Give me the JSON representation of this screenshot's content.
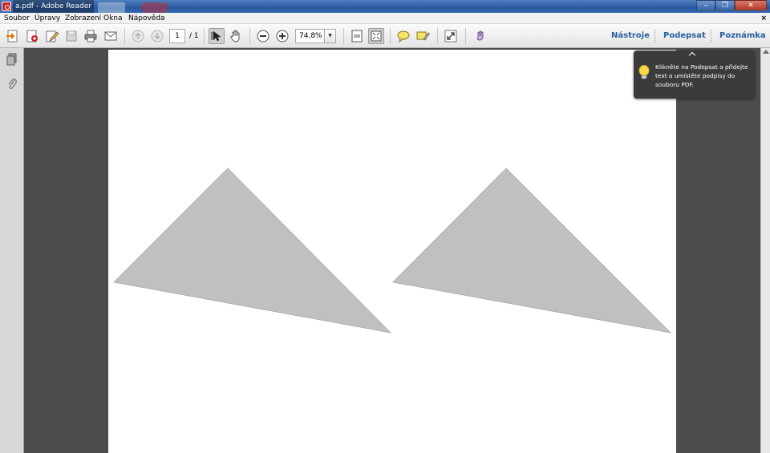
{
  "window": {
    "title": "a.pdf - Adobe Reader",
    "minimize_label": "–",
    "maximize_label": "❐",
    "close_label": "✕"
  },
  "menu": {
    "items": [
      "Soubor",
      "Úpravy",
      "Zobrazení",
      "Okna",
      "Nápověda"
    ],
    "close_label": "×"
  },
  "toolbar": {
    "page_current": "1",
    "page_total": "/ 1",
    "zoom": "74,8%",
    "zoom_dropdown": "▼",
    "links": [
      "Nástroje",
      "Podepsat",
      "Poznámka"
    ]
  },
  "tooltip": {
    "text": "Klikněte na Podepsat a přidejte text a umístěte podpisy do souboru PDF."
  },
  "document": {
    "shapes": [
      "triangle",
      "triangle"
    ],
    "fill_color": "#c0c0c0"
  },
  "colors": {
    "link": "#2a5f9f",
    "canvas": "#4c4c4c",
    "tooltip_bg": "#3b3b3b"
  }
}
